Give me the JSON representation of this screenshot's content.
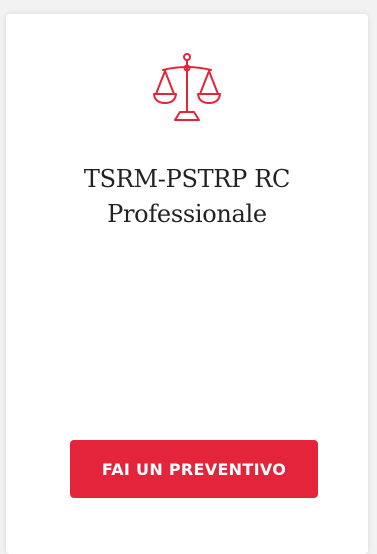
{
  "card": {
    "icon": "scales-of-justice-icon",
    "title_line1": "TSRM-PSTRP RC",
    "title_line2": "Professionale",
    "cta_label": "FAI UN PREVENTIVO"
  },
  "colors": {
    "accent": "#e3243b",
    "title": "#222222",
    "background": "#f2f2f2",
    "card": "#ffffff"
  }
}
